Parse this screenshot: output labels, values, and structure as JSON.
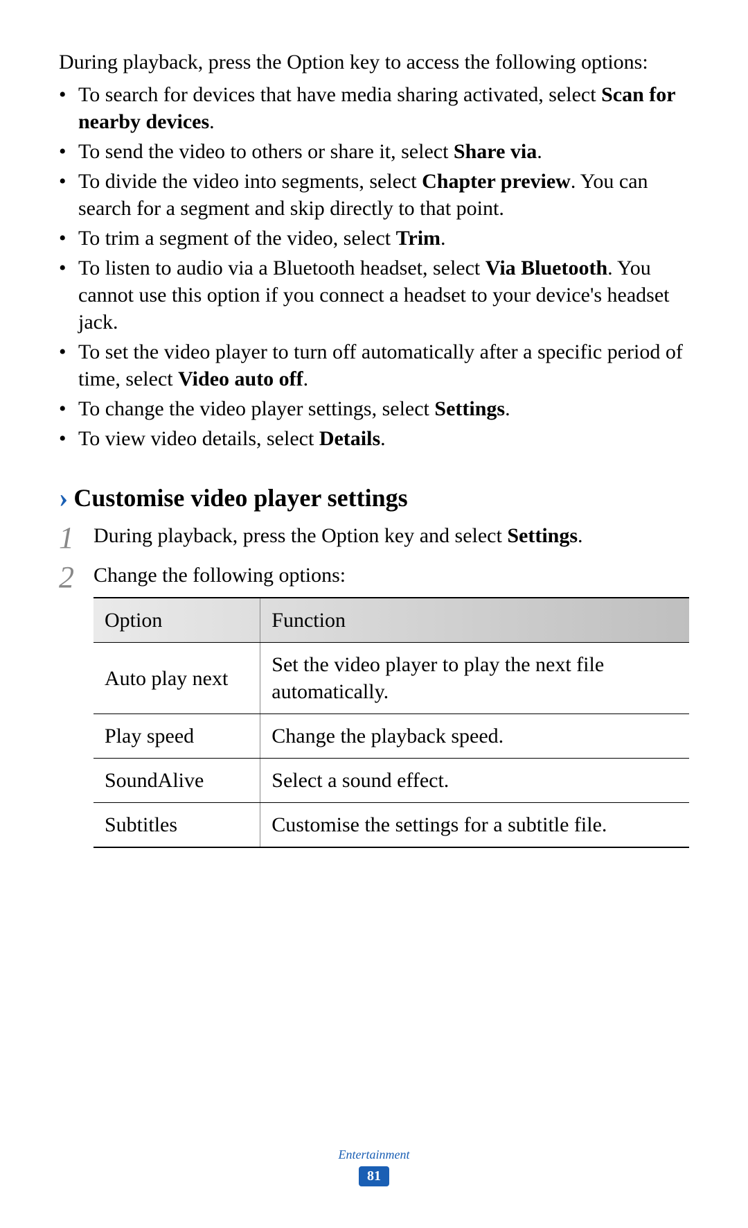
{
  "intro": "During playback, press the Option key to access the following options:",
  "bullets": [
    {
      "pre": "To search for devices that have media sharing activated, select ",
      "bold": "Scan for nearby devices",
      "post": "."
    },
    {
      "pre": "To send the video to others or share it, select ",
      "bold": "Share via",
      "post": "."
    },
    {
      "pre": "To divide the video into segments, select ",
      "bold": "Chapter preview",
      "post": ". You can search for a segment and skip directly to that point."
    },
    {
      "pre": "To trim a segment of the video, select ",
      "bold": "Trim",
      "post": "."
    },
    {
      "pre": "To listen to audio via a Bluetooth headset, select ",
      "bold": "Via Bluetooth",
      "post": ". You cannot use this option if you connect a headset to your device's headset jack."
    },
    {
      "pre": "To set the video player to turn off automatically after a specific period of time, select ",
      "bold": "Video auto off",
      "post": "."
    },
    {
      "pre": "To change the video player settings, select ",
      "bold": "Settings",
      "post": "."
    },
    {
      "pre": "To view video details, select ",
      "bold": "Details",
      "post": "."
    }
  ],
  "section_heading": "Customise video player settings",
  "steps": [
    {
      "num": "1",
      "pre": "During playback, press the Option key and select ",
      "bold": "Settings",
      "post": "."
    },
    {
      "num": "2",
      "pre": "Change the following options:",
      "bold": "",
      "post": ""
    }
  ],
  "table": {
    "headers": {
      "col1": "Option",
      "col2": "Function"
    },
    "rows": [
      {
        "option": "Auto play next",
        "function": "Set the video player to play the next file automatically."
      },
      {
        "option": "Play speed",
        "function": "Change the playback speed."
      },
      {
        "option": "SoundAlive",
        "function": "Select a sound effect."
      },
      {
        "option": "Subtitles",
        "function": "Customise the settings for a subtitle file."
      }
    ]
  },
  "footer": {
    "category": "Entertainment",
    "page": "81"
  }
}
